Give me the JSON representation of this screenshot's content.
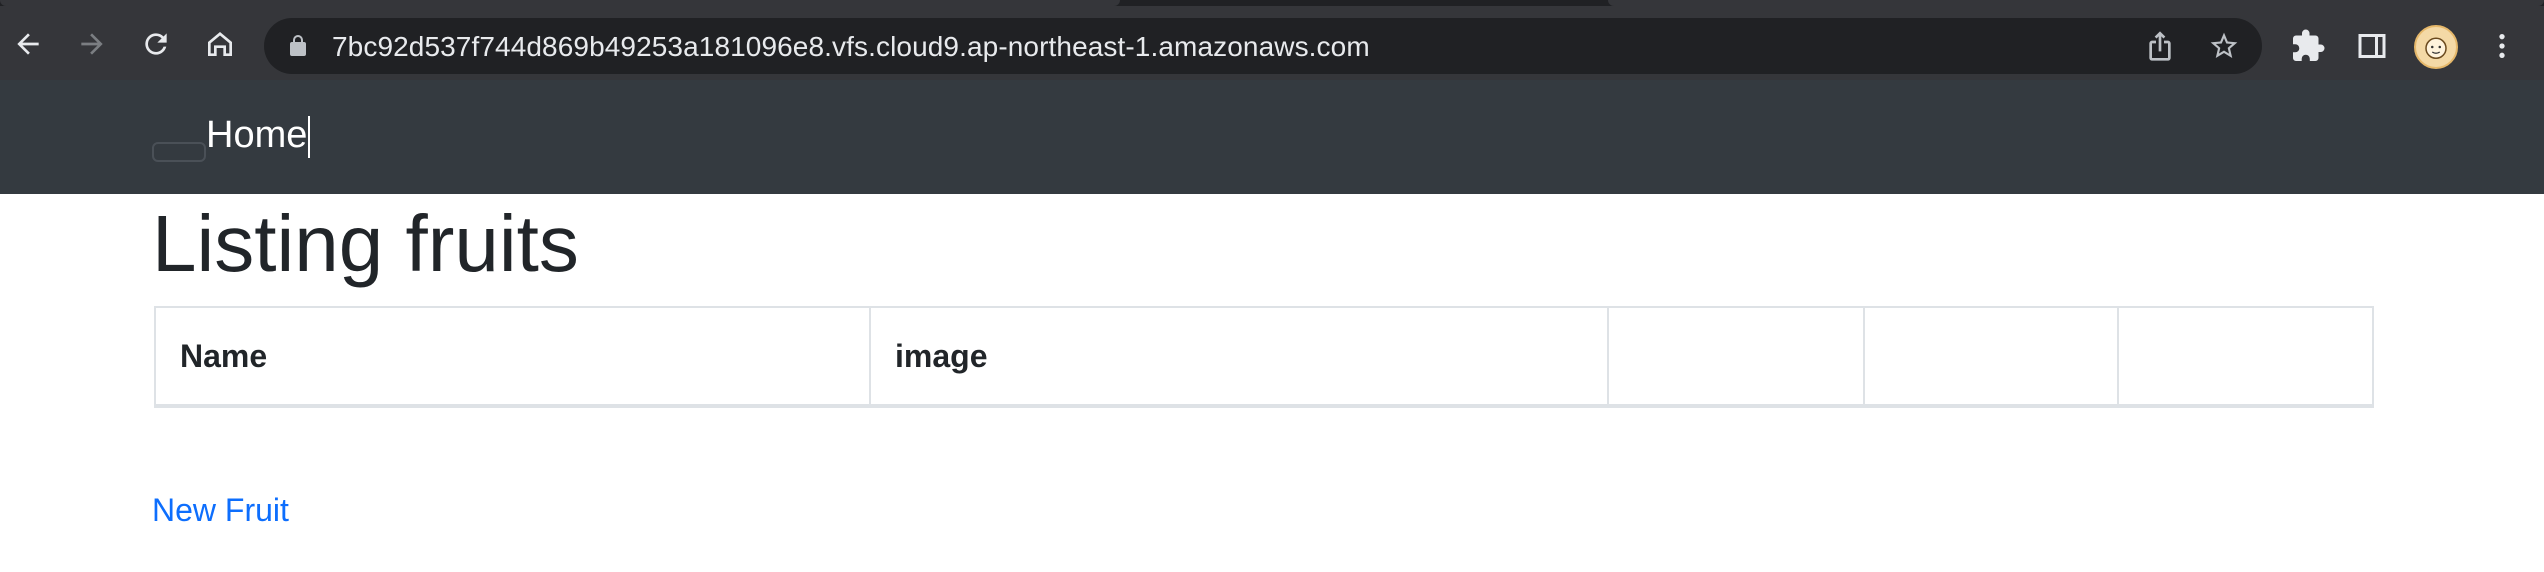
{
  "browser": {
    "url": "7bc92d537f744d869b49253a181096e8.vfs.cloud9.ap-northeast-1.amazonaws.com",
    "icons": [
      "back-icon",
      "forward-icon",
      "reload-icon",
      "home-icon",
      "lock-icon",
      "share-icon",
      "star-icon",
      "extensions-icon",
      "side-panel-icon",
      "avatar",
      "menu-icon"
    ]
  },
  "navbar": {
    "brand": "Home"
  },
  "main": {
    "title": "Listing fruits",
    "table": {
      "headers": [
        "Name",
        "image",
        "",
        "",
        ""
      ]
    },
    "new_link": "New Fruit"
  },
  "colors": {
    "chrome_toolbar": "#35363a",
    "omnibox": "#202124",
    "navbar": "#343a40",
    "link": "#0d6efd",
    "text": "#212529"
  }
}
